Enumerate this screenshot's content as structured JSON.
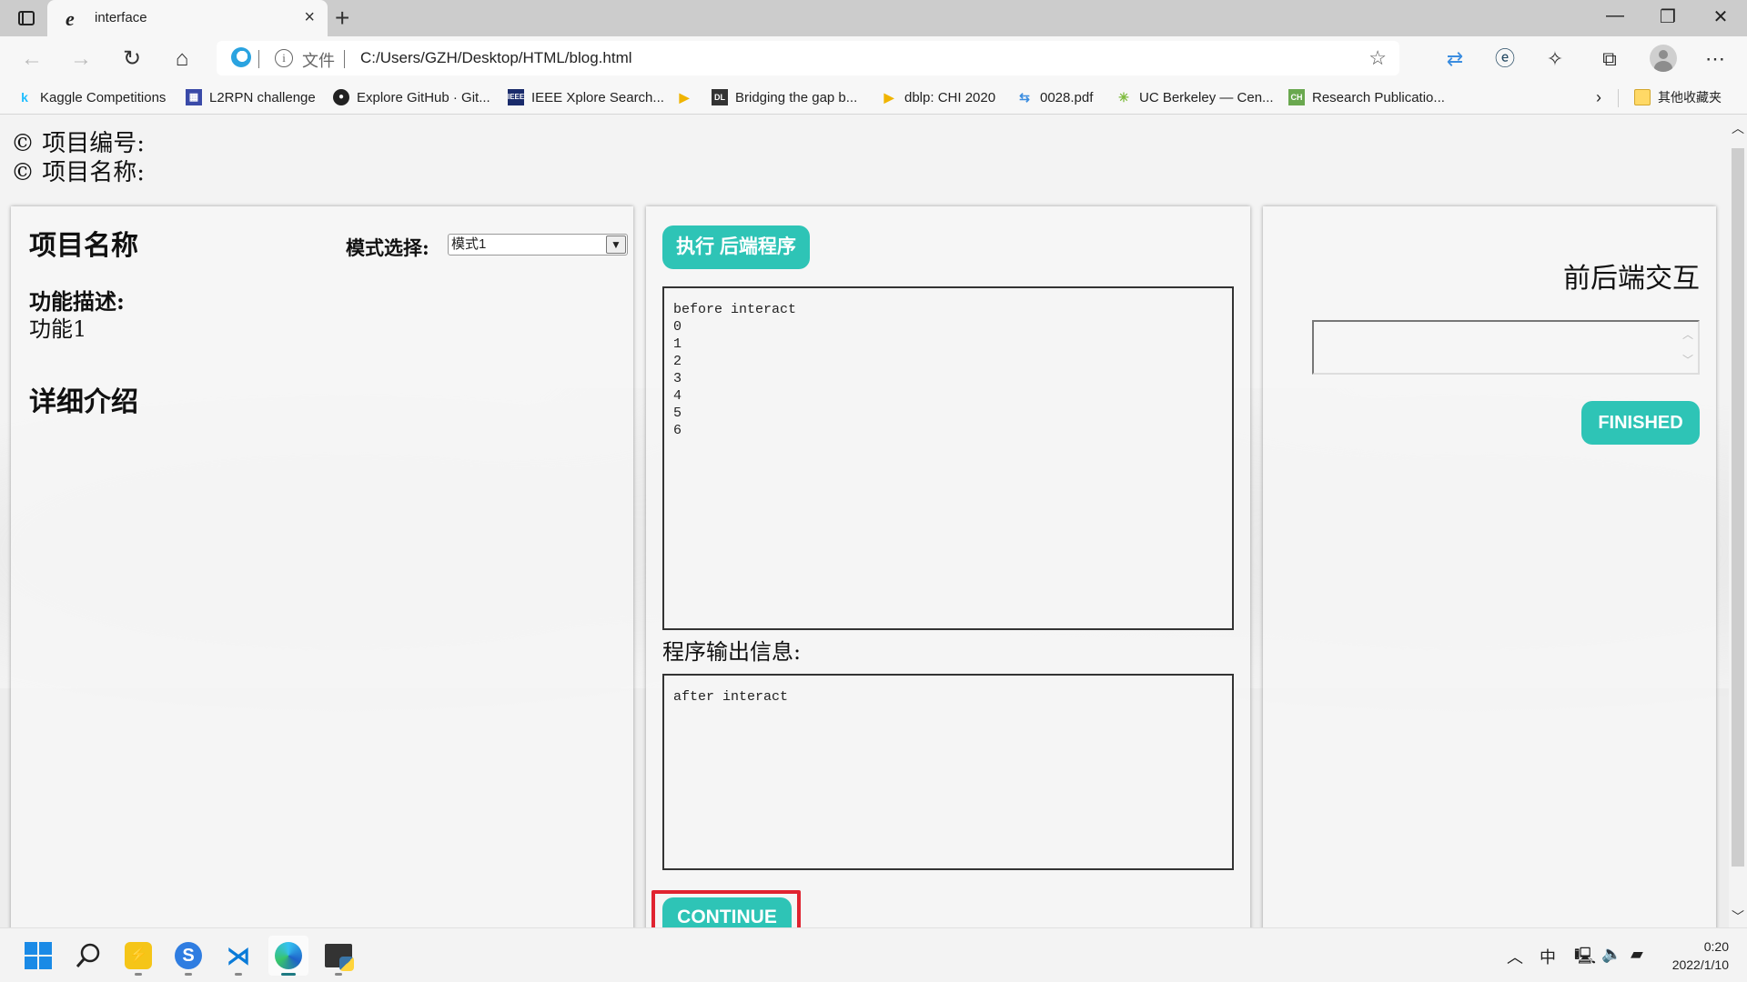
{
  "browser": {
    "tab": {
      "title": "interface",
      "icon": "ie-icon"
    },
    "new_tab_label": "+",
    "window_controls": {
      "minimize": "—",
      "restore": "❐",
      "close": "✕"
    },
    "address": {
      "scheme_label": "文件",
      "url": "C:/Users/GZH/Desktop/HTML/blog.html"
    },
    "bookmarks": [
      {
        "label": "Kaggle Competitions",
        "icon": "kaggle-icon"
      },
      {
        "label": "L2RPN challenge",
        "icon": "l2rpn-icon"
      },
      {
        "label": "Explore GitHub · Git...",
        "icon": "github-icon"
      },
      {
        "label": "IEEE Xplore Search...",
        "icon": "ieee-icon"
      },
      {
        "label": "",
        "icon": "dblp-icon"
      },
      {
        "label": "Bridging the gap b...",
        "icon": "acm-dl-icon"
      },
      {
        "label": "dblp: CHI 2020",
        "icon": "dblp-icon"
      },
      {
        "label": "0028.pdf",
        "icon": "pdf-sync-icon"
      },
      {
        "label": "UC Berkeley — Cen...",
        "icon": "berkeley-icon"
      },
      {
        "label": "Research Publicatio...",
        "icon": "chai-icon"
      }
    ],
    "other_bookmarks": "其他收藏夹"
  },
  "page": {
    "project_number_label": "© 项目编号:",
    "project_name_label": "© 项目名称:",
    "left": {
      "title": "项目名称",
      "mode_label": "模式选择:",
      "mode_selected": "模式1",
      "function_label": "功能描述:",
      "function_value": "功能1",
      "detail_title": "详细介绍"
    },
    "middle": {
      "run_button": "执行 后端程序",
      "console_top": "before interact\n0\n1\n2\n3\n4\n5\n6",
      "output_label": "程序输出信息:",
      "console_bottom": "after interact",
      "continue_button": "CONTINUE"
    },
    "right": {
      "title": "前后端交互",
      "input_value": "",
      "finished_button": "FINISHED"
    }
  },
  "taskbar": {
    "apps": [
      "start",
      "search",
      "ld-player",
      "sogou",
      "vscode",
      "edge",
      "python-idle"
    ],
    "ime": "中",
    "time": "0:20",
    "date": "2022/1/10"
  },
  "colors": {
    "accent": "#2ec4b6",
    "highlight": "#e02330"
  }
}
